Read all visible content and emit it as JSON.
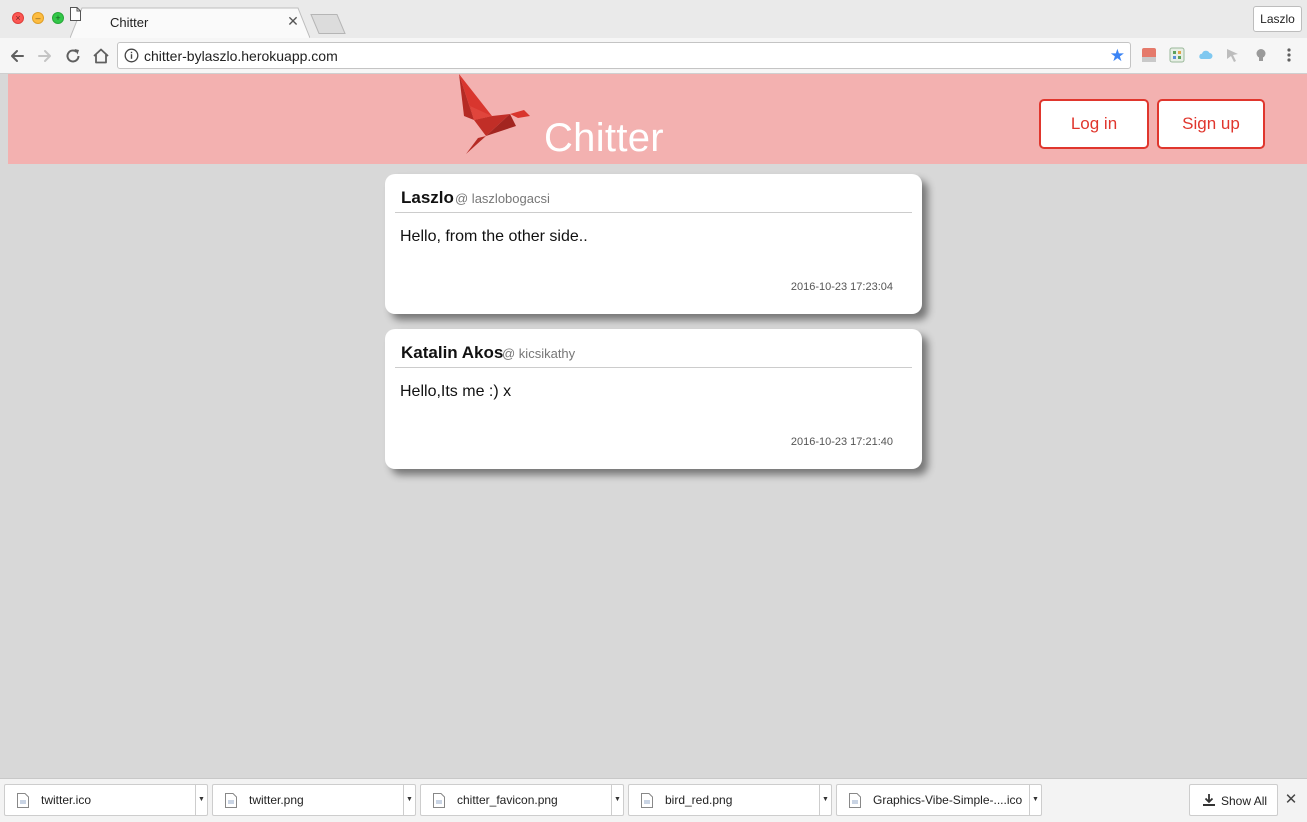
{
  "browser": {
    "tab": {
      "title": "Chitter"
    },
    "profile_label": "Laszlo",
    "address_bar": {
      "url": "chitter-bylaszlo.herokuapp.com"
    },
    "icons": {
      "back": "back-arrow-icon",
      "forward": "forward-arrow-icon",
      "reload": "reload-icon",
      "home": "home-icon",
      "info": "info-icon",
      "bookmark": "star-icon"
    }
  },
  "header": {
    "brand": "Chitter",
    "login_label": "Log in",
    "signup_label": "Sign up",
    "colors": {
      "background": "#f3b1b0",
      "accent": "#e0362d"
    }
  },
  "peeps": [
    {
      "name": "Laszlo",
      "handle": "@ laszlobogacsi",
      "message": "Hello, from the other side..",
      "time": "2016-10-23 17:23:04"
    },
    {
      "name": "Katalin Akos",
      "handle": "@ kicsikathy",
      "message": "Hello,Its me :) x",
      "time": "2016-10-23 17:21:40"
    }
  ],
  "downloads": {
    "items": [
      {
        "name": "twitter.ico"
      },
      {
        "name": "twitter.png"
      },
      {
        "name": "chitter_favicon.png"
      },
      {
        "name": "bird_red.png"
      },
      {
        "name": "Graphics-Vibe-Simple-....ico"
      }
    ],
    "show_all_label": "Show All",
    "close_glyph": "✕"
  }
}
